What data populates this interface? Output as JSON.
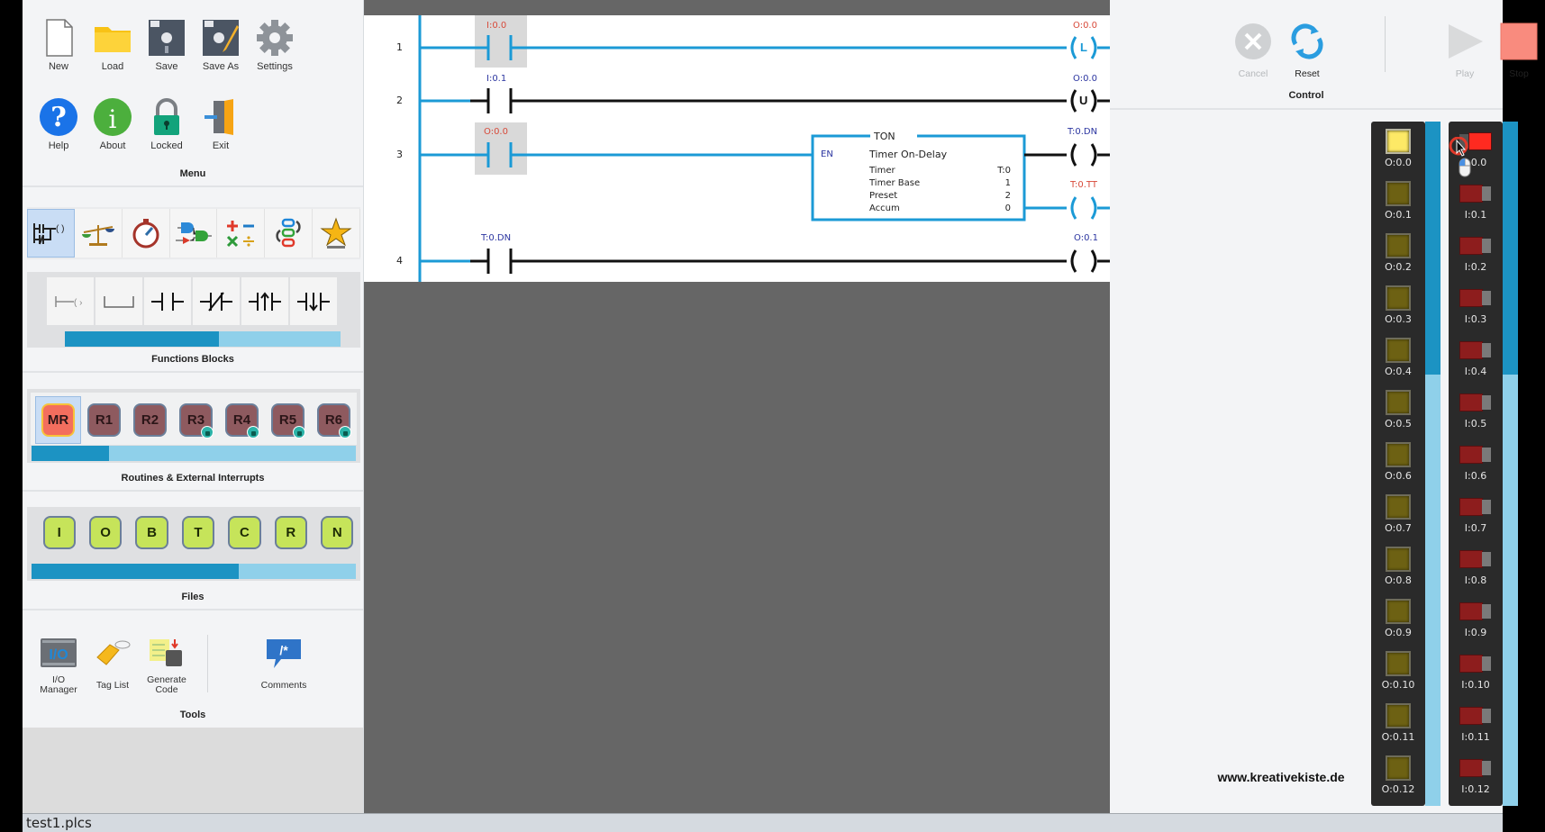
{
  "sidebar": {
    "menu": {
      "title": "Menu",
      "items": [
        {
          "label": "New",
          "icon": "new-file-icon"
        },
        {
          "label": "Load",
          "icon": "folder-icon"
        },
        {
          "label": "Save",
          "icon": "floppy-disk-icon"
        },
        {
          "label": "Save As",
          "icon": "floppy-pencil-icon"
        },
        {
          "label": "Settings",
          "icon": "gear-icon"
        },
        {
          "label": "Help",
          "icon": "question-icon"
        },
        {
          "label": "About",
          "icon": "info-icon"
        },
        {
          "label": "Locked",
          "icon": "padlock-icon"
        },
        {
          "label": "Exit",
          "icon": "exit-door-icon"
        }
      ]
    },
    "function_blocks": {
      "title": "Functions Blocks",
      "categories": [
        "bit-instructions",
        "compare",
        "timer",
        "logic-gates",
        "math",
        "move",
        "favorites"
      ],
      "active_category": 0,
      "elements": [
        "branch",
        "empty-rung",
        "normally-open-contact",
        "normally-closed-contact",
        "positive-edge-contact",
        "negative-edge-contact"
      ],
      "scroll_fraction": 0.56
    },
    "routines": {
      "title": "Routines & External Interrupts",
      "items": [
        {
          "label": "MR",
          "active": true,
          "locked": false
        },
        {
          "label": "R1",
          "locked": false
        },
        {
          "label": "R2",
          "locked": false
        },
        {
          "label": "R3",
          "locked": true
        },
        {
          "label": "R4",
          "locked": true
        },
        {
          "label": "R5",
          "locked": true
        },
        {
          "label": "R6",
          "locked": true
        }
      ],
      "scroll_fraction": 0.24
    },
    "files": {
      "title": "Files",
      "items": [
        "I",
        "O",
        "B",
        "T",
        "C",
        "R",
        "N"
      ],
      "scroll_fraction": 0.64
    },
    "tools": {
      "title": "Tools",
      "items": [
        {
          "label_line1": "I/O",
          "label_line2": "Manager",
          "icon": "io-manager-icon"
        },
        {
          "label_line1": "Tag List",
          "label_line2": "",
          "icon": "tag-icon"
        },
        {
          "label_line1": "Generate",
          "label_line2": "Code",
          "icon": "generate-code-icon"
        },
        {
          "label_line1": "Comments",
          "label_line2": "",
          "icon": "comment-bubble-icon"
        }
      ]
    }
  },
  "ladder": {
    "rungs": [
      {
        "number": "1",
        "contact_tag": "I:0.0",
        "contact_tag_state": "active",
        "coil_tag": "O:0.0",
        "coil_type": "L",
        "coil_state": "active"
      },
      {
        "number": "2",
        "contact_tag": "I:0.1",
        "contact_tag_state": "inactive",
        "coil_tag": "O:0.0",
        "coil_type": "U",
        "coil_state": "inactive"
      },
      {
        "number": "3",
        "contact_tag": "O:0.0",
        "contact_tag_state": "active",
        "coil_tag": "T:0.DN",
        "coil_type": "",
        "coil_state": "inactive",
        "coil2_tag": "T:0.TT",
        "coil2_state": "active"
      },
      {
        "number": "4",
        "contact_tag": "T:0.DN",
        "contact_tag_state": "inactive",
        "coil_tag": "O:0.1",
        "coil_type": "",
        "coil_state": "inactive"
      }
    ],
    "timer_block": {
      "header": "TON",
      "enable": "EN",
      "title": "Timer On-Delay",
      "rows": [
        {
          "label": "Timer",
          "value": "T:0"
        },
        {
          "label": "Timer Base",
          "value": "1"
        },
        {
          "label": "Preset",
          "value": "2"
        },
        {
          "label": "Accum",
          "value": "0"
        }
      ]
    }
  },
  "control": {
    "title": "Control",
    "buttons": [
      {
        "label": "Cancel",
        "enabled": false,
        "icon": "cancel-x-icon"
      },
      {
        "label": "Reset",
        "enabled": true,
        "icon": "reset-arrows-icon"
      },
      {
        "label": "Play",
        "enabled": false,
        "icon": "play-icon"
      },
      {
        "label": "Stop",
        "enabled": true,
        "icon": "stop-square-icon"
      }
    ]
  },
  "outputs": [
    {
      "label": "O:0.0",
      "on": true
    },
    {
      "label": "O:0.1",
      "on": false
    },
    {
      "label": "O:0.2",
      "on": false
    },
    {
      "label": "O:0.3",
      "on": false
    },
    {
      "label": "O:0.4",
      "on": false
    },
    {
      "label": "O:0.5",
      "on": false
    },
    {
      "label": "O:0.6",
      "on": false
    },
    {
      "label": "O:0.7",
      "on": false
    },
    {
      "label": "O:0.8",
      "on": false
    },
    {
      "label": "O:0.9",
      "on": false
    },
    {
      "label": "O:0.10",
      "on": false
    },
    {
      "label": "O:0.11",
      "on": false
    },
    {
      "label": "O:0.12",
      "on": false
    }
  ],
  "inputs": [
    {
      "label": "I:0.0",
      "on": true
    },
    {
      "label": "I:0.1",
      "on": false
    },
    {
      "label": "I:0.2",
      "on": false
    },
    {
      "label": "I:0.3",
      "on": false
    },
    {
      "label": "I:0.4",
      "on": false
    },
    {
      "label": "I:0.5",
      "on": false
    },
    {
      "label": "I:0.6",
      "on": false
    },
    {
      "label": "I:0.7",
      "on": false
    },
    {
      "label": "I:0.8",
      "on": false
    },
    {
      "label": "I:0.9",
      "on": false
    },
    {
      "label": "I:0.10",
      "on": false
    },
    {
      "label": "I:0.11",
      "on": false
    },
    {
      "label": "I:0.12",
      "on": false
    }
  ],
  "io_scroll_fraction": 0.37,
  "website": "www.kreativekiste.de",
  "status_bar": {
    "filename": "test1.plcs"
  },
  "colors": {
    "energized": "#1b9ad6",
    "accent": "#1c93c3",
    "active_tag": "#d84a3a",
    "inactive_tag": "#2b35a0"
  }
}
